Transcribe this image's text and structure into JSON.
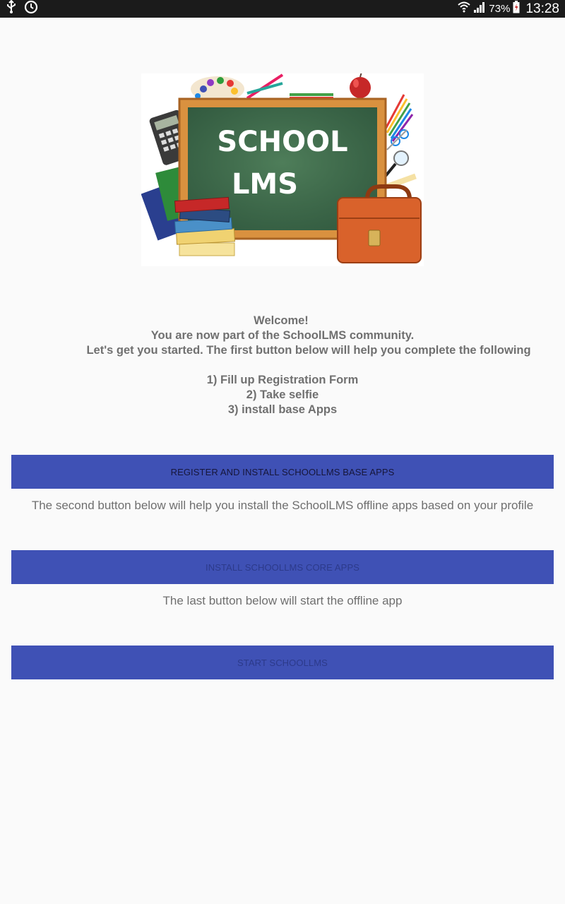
{
  "status_bar": {
    "battery_percent": "73%",
    "time": "13:28"
  },
  "logo": {
    "text_line1": "SCHOOL",
    "text_line2": "LMS"
  },
  "intro": {
    "line1": "Welcome!",
    "line2": "You are now part of the SchoolLMS community.",
    "line3": "Let's get you started. The first button below will help you complete the following",
    "step1": "1) Fill up Registration Form",
    "step2": "2) Take selfie",
    "step3": "3) install base Apps"
  },
  "buttons": {
    "register": "REGISTER AND INSTALL SCHOOLLMS BASE APPS",
    "install_core": "INSTALL SCHOOLLMS CORE APPS",
    "start": "START SCHOOLLMS"
  },
  "notes": {
    "second": "The second button below will help you install the SchoolLMS offline apps based on your profile",
    "last": "The last button below will start the offline app"
  },
  "colors": {
    "button": "#3f51b5",
    "background": "#fafafa",
    "status_bar": "#1b1b1b"
  }
}
